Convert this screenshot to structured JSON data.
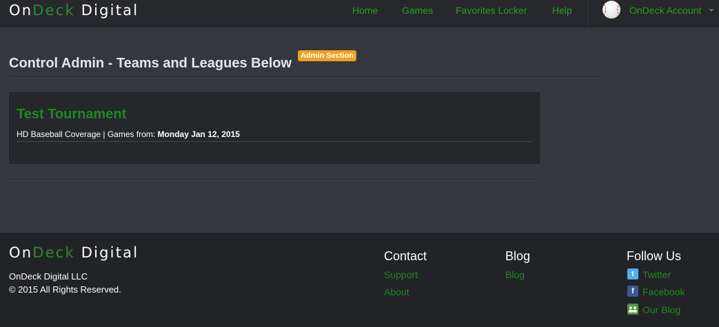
{
  "nav": {
    "brand": {
      "part1": "On",
      "part2": "Deck",
      "part3": " Digital"
    },
    "links": [
      "Home",
      "Games",
      "Favorites Locker",
      "Help"
    ],
    "account": "OnDeck Account"
  },
  "main": {
    "title": "Control Admin - Teams and Leagues Below",
    "badge": "Admin Section",
    "card": {
      "title": "Test Tournament",
      "meta_prefix": "HD Baseball Coverage | Games from: ",
      "meta_date": "Monday Jan 12, 2015"
    }
  },
  "footer": {
    "brand": {
      "part1": "On",
      "part2": "Deck",
      "part3": " Digital"
    },
    "company": "OnDeck Digital LLC",
    "copyright": "© 2015 All Rights Reserved.",
    "contact": {
      "heading": "Contact",
      "links": [
        "Support",
        "About"
      ]
    },
    "blog": {
      "heading": "Blog",
      "links": [
        "Blog"
      ]
    },
    "follow": {
      "heading": "Follow Us",
      "links": [
        "Twitter",
        "Facebook",
        "Our Blog"
      ]
    }
  },
  "colors": {
    "accent_green": "#1f8a1f",
    "badge_orange": "#f0a020",
    "background": "#34373e"
  },
  "icons": [
    "baseball-avatar-icon",
    "caret-down-icon",
    "twitter-icon",
    "facebook-icon",
    "blog-users-icon"
  ]
}
